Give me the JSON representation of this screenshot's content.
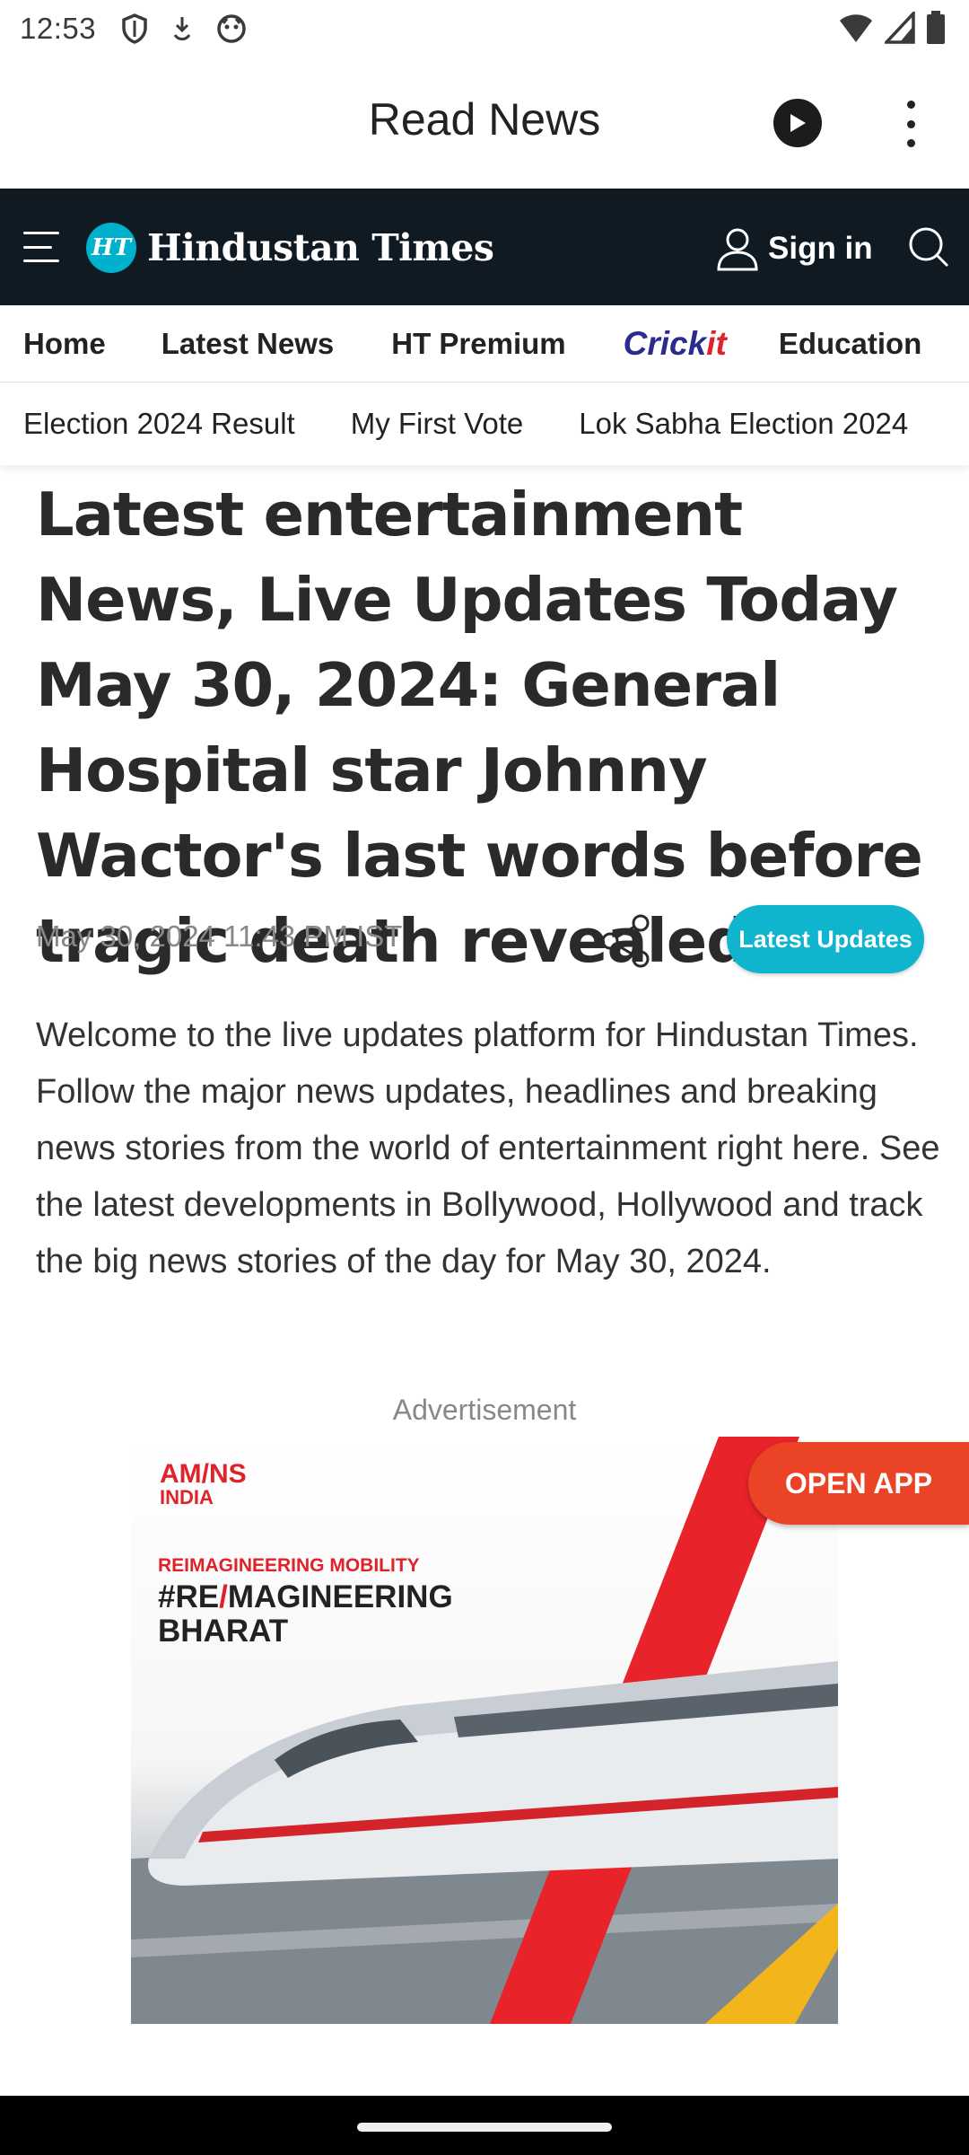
{
  "status_bar": {
    "time": "12:53"
  },
  "app_bar": {
    "title": "Read News"
  },
  "site_header": {
    "logo_badge": "HT",
    "logo_text": "Hindustan Times",
    "sign_in_label": "Sign in"
  },
  "nav": {
    "primary": [
      {
        "label": "Home"
      },
      {
        "label": "Latest News"
      },
      {
        "label": "HT Premium"
      },
      {
        "label": "Crick"
      },
      {
        "label": "Education"
      }
    ],
    "cricket_logo": {
      "main": "Crick",
      "suffix": "it"
    },
    "secondary": [
      {
        "label": "Election 2024 Result"
      },
      {
        "label": "My First Vote"
      },
      {
        "label": "Lok Sabha Election 2024"
      }
    ]
  },
  "article": {
    "headline": "Latest entertainment News, Live Updates Today May 30, 2024: General Hospital star Johnny Wactor's last words before tragic death revealed",
    "date": "May 30, 2024 11:43 PM IST",
    "latest_updates_label": "Latest Updates",
    "summary": "Welcome to the live updates platform for Hindustan Times. Follow the major news updates, headlines and breaking news stories from the world of entertainment right here. See the latest developments in Bollywood, Hollywood and track the big news stories of the day for May 30, 2024."
  },
  "advertisement": {
    "label": "Advertisement",
    "brand_line1": "AM/NS",
    "brand_line2": "INDIA",
    "tagline": "REIMAGINEERING MOBILITY",
    "headline_part1": "#RE",
    "headline_slash": "/",
    "headline_part2": "MAGINEERING",
    "headline_line2": "BHARAT",
    "open_app_label": "OPEN APP"
  },
  "colors": {
    "header_bg": "#0f1a23",
    "accent_cyan": "#0fb4cf",
    "ad_red": "#e0232a",
    "open_app_orange": "#ea4326"
  }
}
